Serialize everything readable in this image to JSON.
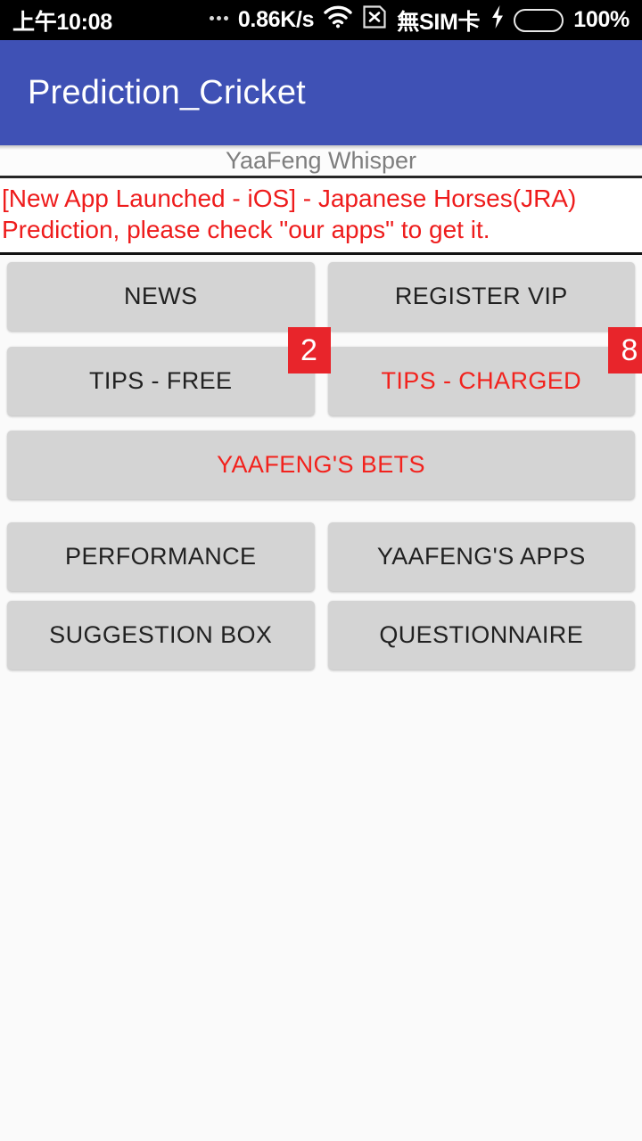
{
  "status_bar": {
    "clock": "上午10:08",
    "dots_icon": "more-dots-icon",
    "network_speed": "0.86K/s",
    "wifi_icon": "wifi-icon",
    "sim_slot_icon": "sim-disabled-icon",
    "sim_text": "無SIM卡",
    "charging_icon": "lightning-bolt-icon",
    "battery_level_pct": 100,
    "battery_text": "100%",
    "battery_color": "#3ddc18",
    "background": "#000000"
  },
  "app_bar": {
    "title": "Prediction_Cricket",
    "background": "#3f51b5",
    "text_color": "#ffffff"
  },
  "subtitle": {
    "text": "YaaFeng Whisper",
    "color": "#7e7e7e"
  },
  "announcement": {
    "color": "#ee1c1c",
    "line1": "[New App Launched - iOS] - Japanese Horses(JRA)",
    "line2": "Prediction, please check \"our apps\" to get it."
  },
  "menu": {
    "button_bg": "#d4d4d4",
    "default_text_color": "#212121",
    "highlight_text_color": "#f2221d",
    "badge_bg": "#e8252b",
    "badge_text_color": "#ffffff",
    "rows": [
      {
        "buttons": [
          {
            "name": "news",
            "label": "NEWS",
            "highlighted": false,
            "badge": null
          },
          {
            "name": "register-vip",
            "label": "REGISTER VIP",
            "highlighted": false,
            "badge": null
          }
        ]
      },
      {
        "buttons": [
          {
            "name": "tips-free",
            "label": "TIPS - FREE",
            "highlighted": false,
            "badge": "2"
          },
          {
            "name": "tips-charged",
            "label": "TIPS - CHARGED",
            "highlighted": true,
            "badge": "8"
          }
        ]
      },
      {
        "buttons": [
          {
            "name": "yaafengs-bets",
            "label": "YAAFENG'S BETS",
            "highlighted": true,
            "badge": null
          }
        ]
      },
      {
        "buttons": [
          {
            "name": "performance",
            "label": "PERFORMANCE",
            "highlighted": false,
            "badge": null
          },
          {
            "name": "yaafengs-apps",
            "label": "YAAFENG'S APPS",
            "highlighted": false,
            "badge": null
          }
        ]
      },
      {
        "buttons": [
          {
            "name": "suggestion-box",
            "label": "SUGGESTION BOX",
            "highlighted": false,
            "badge": null
          },
          {
            "name": "questionnaire",
            "label": "QUESTIONNAIRE",
            "highlighted": false,
            "badge": null
          }
        ]
      }
    ]
  }
}
